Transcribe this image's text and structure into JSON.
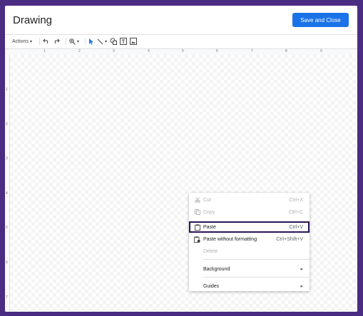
{
  "dialog": {
    "title": "Drawing",
    "save_label": "Save and Close"
  },
  "toolbar": {
    "actions_label": "Actions",
    "actions_caret": "▾",
    "zoom_caret": "▾",
    "line_caret": "▾"
  },
  "ruler": {
    "top_labels": [
      "1",
      "2",
      "3",
      "4",
      "5",
      "6",
      "7",
      "8",
      "9"
    ],
    "left_labels": [
      "1",
      "2",
      "3",
      "4",
      "5",
      "6",
      "7"
    ]
  },
  "context_menu": {
    "items": [
      {
        "label": "Cut",
        "shortcut": "Ctrl+X",
        "icon": "cut-icon",
        "enabled": false
      },
      {
        "label": "Copy",
        "shortcut": "Ctrl+C",
        "icon": "copy-icon",
        "enabled": false
      },
      {
        "label": "Paste",
        "shortcut": "Ctrl+V",
        "icon": "paste-icon",
        "enabled": true,
        "highlighted": true
      },
      {
        "label": "Paste without formatting",
        "shortcut": "Ctrl+Shift+V",
        "icon": "paste-plain-icon",
        "enabled": true
      },
      {
        "label": "Delete",
        "shortcut": "",
        "enabled": false
      },
      {
        "label": "Background",
        "submenu_arrow": "▸",
        "enabled": true
      },
      {
        "label": "Guides",
        "submenu_arrow": "▸",
        "enabled": true
      }
    ]
  },
  "colors": {
    "accent": "#1a73e8",
    "frame": "#4b2c83",
    "highlight_border": "#2a1456"
  }
}
